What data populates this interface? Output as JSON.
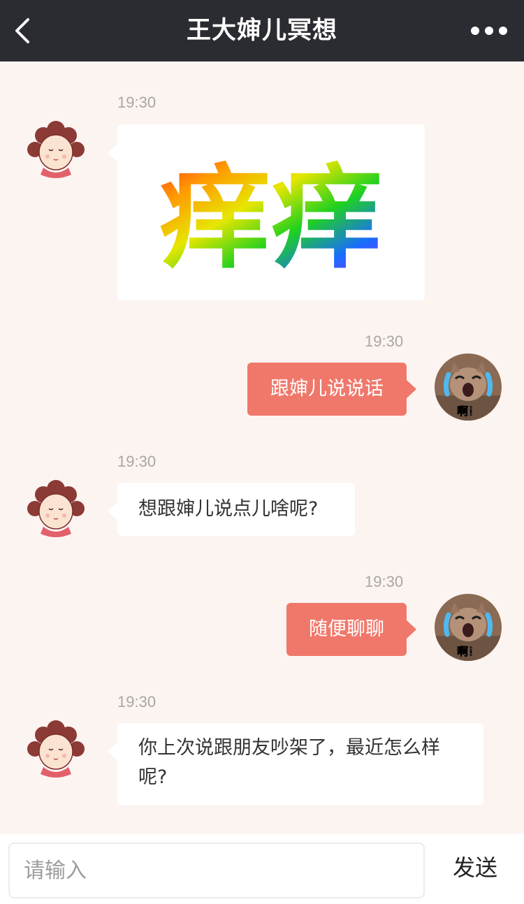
{
  "header": {
    "title": "王大婶儿冥想",
    "back_icon": "chevron-left-icon",
    "more_icon": "more-dots-icon"
  },
  "messages": [
    {
      "time": "19:30",
      "sender": "bot",
      "type": "image",
      "image_text": "痒痒"
    },
    {
      "time": "19:30",
      "sender": "user",
      "type": "text",
      "text": "跟婶儿说说话",
      "avatar_text": "啊！"
    },
    {
      "time": "19:30",
      "sender": "bot",
      "type": "text",
      "text": "想跟婶儿说点儿啥呢?"
    },
    {
      "time": "19:30",
      "sender": "user",
      "type": "text",
      "text": "随便聊聊",
      "avatar_text": "啊！"
    },
    {
      "time": "19:30",
      "sender": "bot",
      "type": "text",
      "text": "你上次说跟朋友吵架了，最近怎么样呢?"
    }
  ],
  "input": {
    "placeholder": "请输入",
    "value": ""
  },
  "send_label": "发送",
  "colors": {
    "header_bg": "#2b2c31",
    "chat_bg": "#fcf4f1",
    "user_bubble": "#f0786b",
    "bot_bubble": "#ffffff"
  }
}
